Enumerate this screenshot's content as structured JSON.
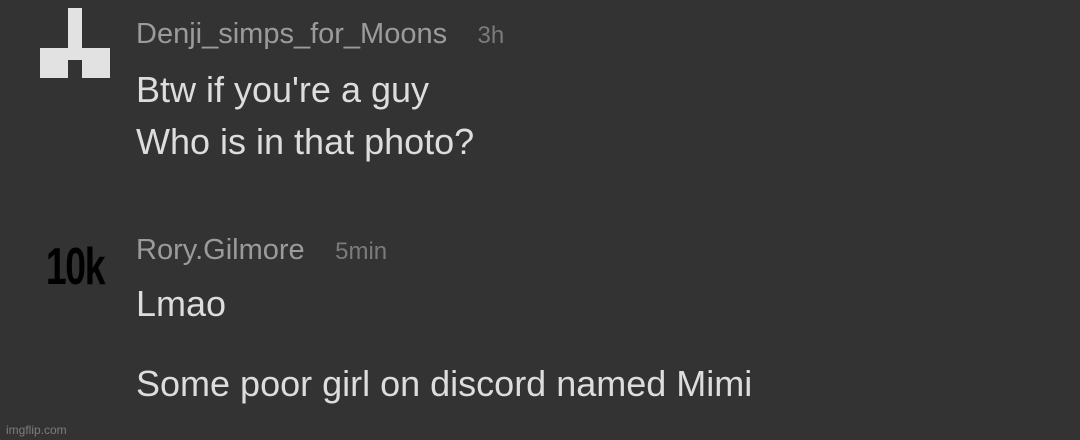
{
  "app": {
    "background_color": "#333333",
    "text_color": "#dddddd",
    "username_color": "#9b9b9b",
    "time_color": "#7b7b7b"
  },
  "comments": [
    {
      "username": "Denji_simps_for_Moons",
      "time": "3h",
      "avatar_icon": "pixel-shape-icon",
      "lines": [
        "Btw if you're a guy",
        "Who is in that photo?"
      ]
    },
    {
      "username": "Rory.Gilmore",
      "time": "5min",
      "avatar_text": "10k",
      "lines": [
        "Lmao",
        "Some poor girl on discord named Mimi"
      ]
    }
  ],
  "watermark": "imgflip.com"
}
